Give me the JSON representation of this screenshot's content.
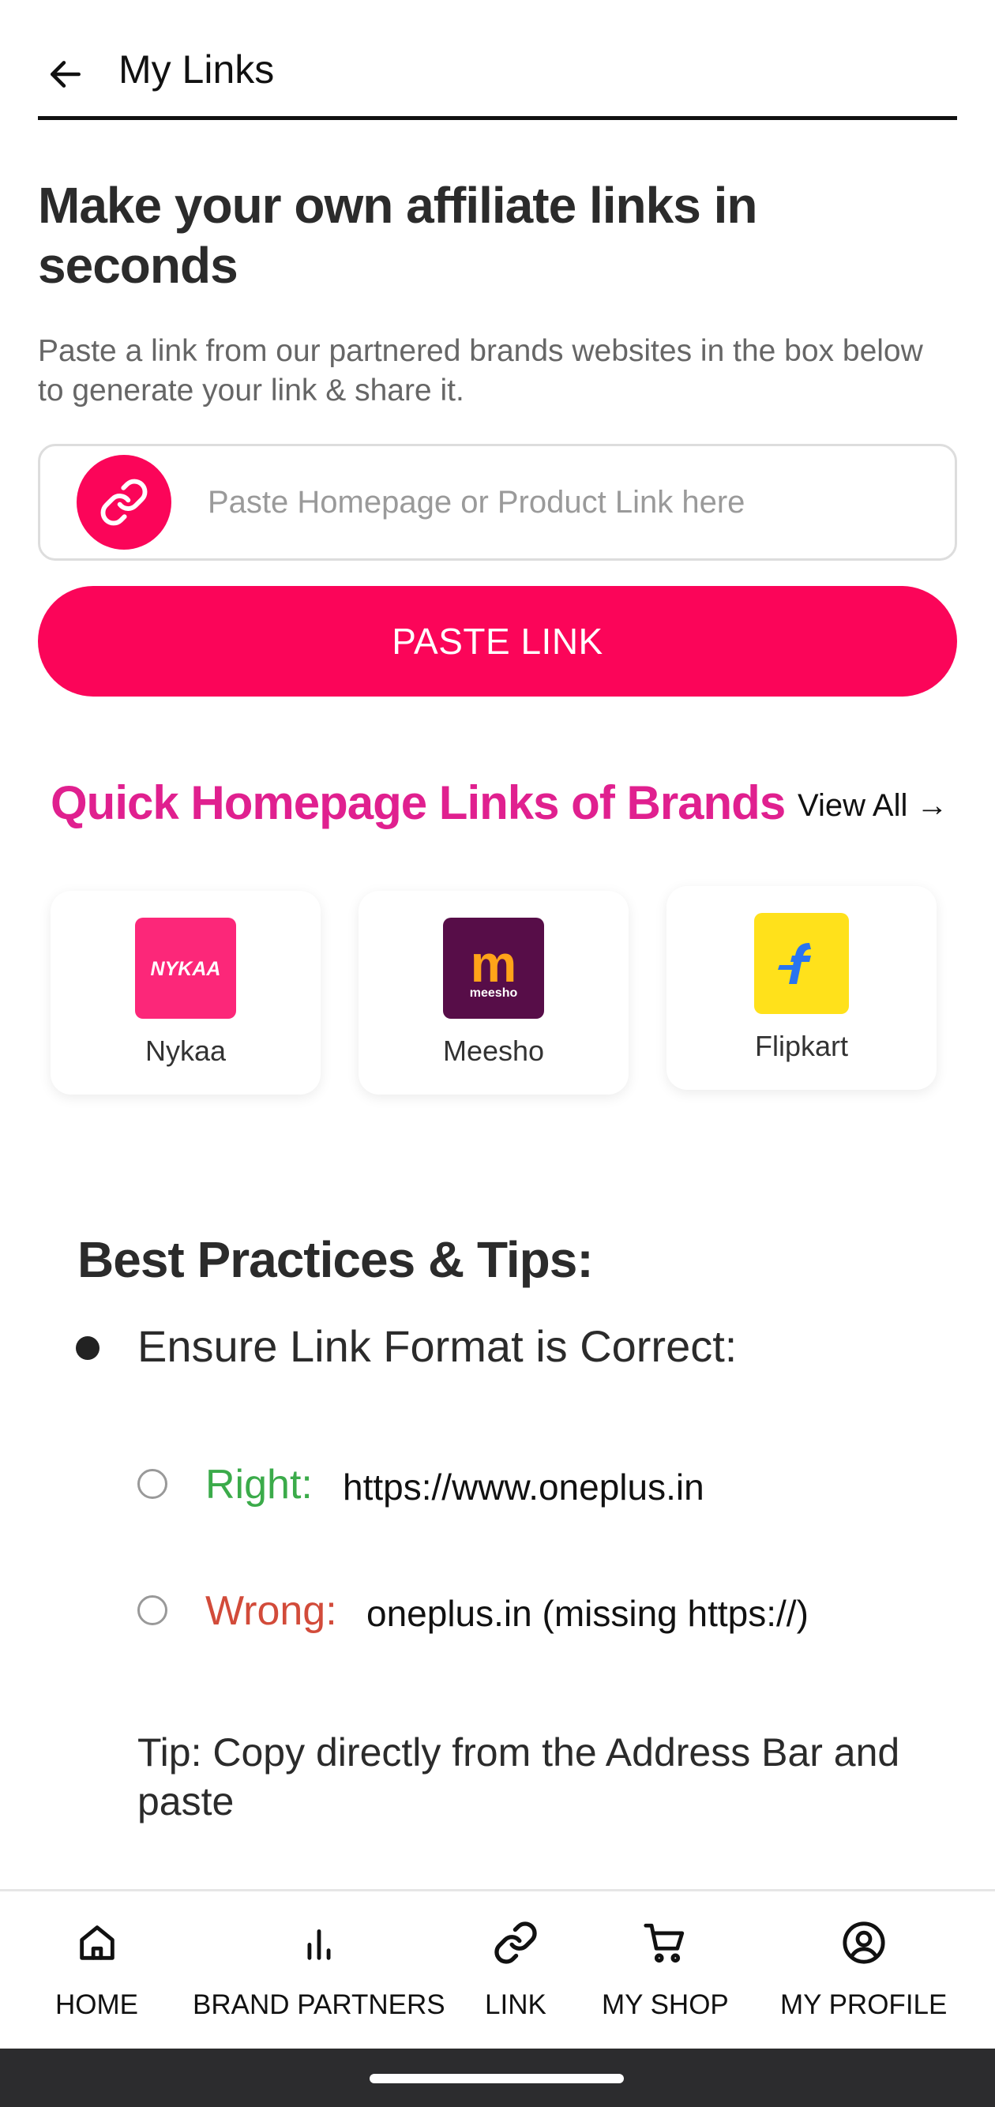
{
  "header": {
    "title": "My Links"
  },
  "hero": {
    "title": "Make your own affiliate links in seconds",
    "subtitle": "Paste a link from our partnered brands websites in the box below to generate your link & share it."
  },
  "link_input": {
    "placeholder": "Paste Homepage or Product Link here",
    "value": ""
  },
  "paste_button": {
    "label": "PASTE LINK"
  },
  "quick_links": {
    "title": "Quick Homepage Links of Brands",
    "view_all": "View All →",
    "brands": [
      {
        "name": "Nykaa",
        "logo_text": "NYKAA",
        "color": "#fc2779"
      },
      {
        "name": "Meesho",
        "logo_text": "meesho",
        "logo_letter": "m",
        "color": "#570d48"
      },
      {
        "name": "Flipkart",
        "logo_text": "f",
        "color": "#ffe11b"
      }
    ]
  },
  "tips": {
    "title": "Best Practices & Tips:",
    "item": "Ensure Link Format is Correct:",
    "right_label": "Right:",
    "right_example": "https://www.oneplus.in",
    "wrong_label": "Wrong:",
    "wrong_example": "oneplus.in (missing https://)",
    "tip": "Tip: Copy directly from the Address Bar and paste"
  },
  "bottom_nav": {
    "items": [
      {
        "label": "HOME",
        "icon": "home-icon"
      },
      {
        "label": "BRAND PARTNERS",
        "icon": "bar-chart-icon"
      },
      {
        "label": "LINK",
        "icon": "link-icon"
      },
      {
        "label": "MY SHOP",
        "icon": "cart-icon"
      },
      {
        "label": "MY PROFILE",
        "icon": "profile-icon"
      }
    ]
  },
  "colors": {
    "accent": "#fb0559",
    "heading_pink": "#e0208f",
    "right": "#3bab4a",
    "wrong": "#d24b3a"
  }
}
